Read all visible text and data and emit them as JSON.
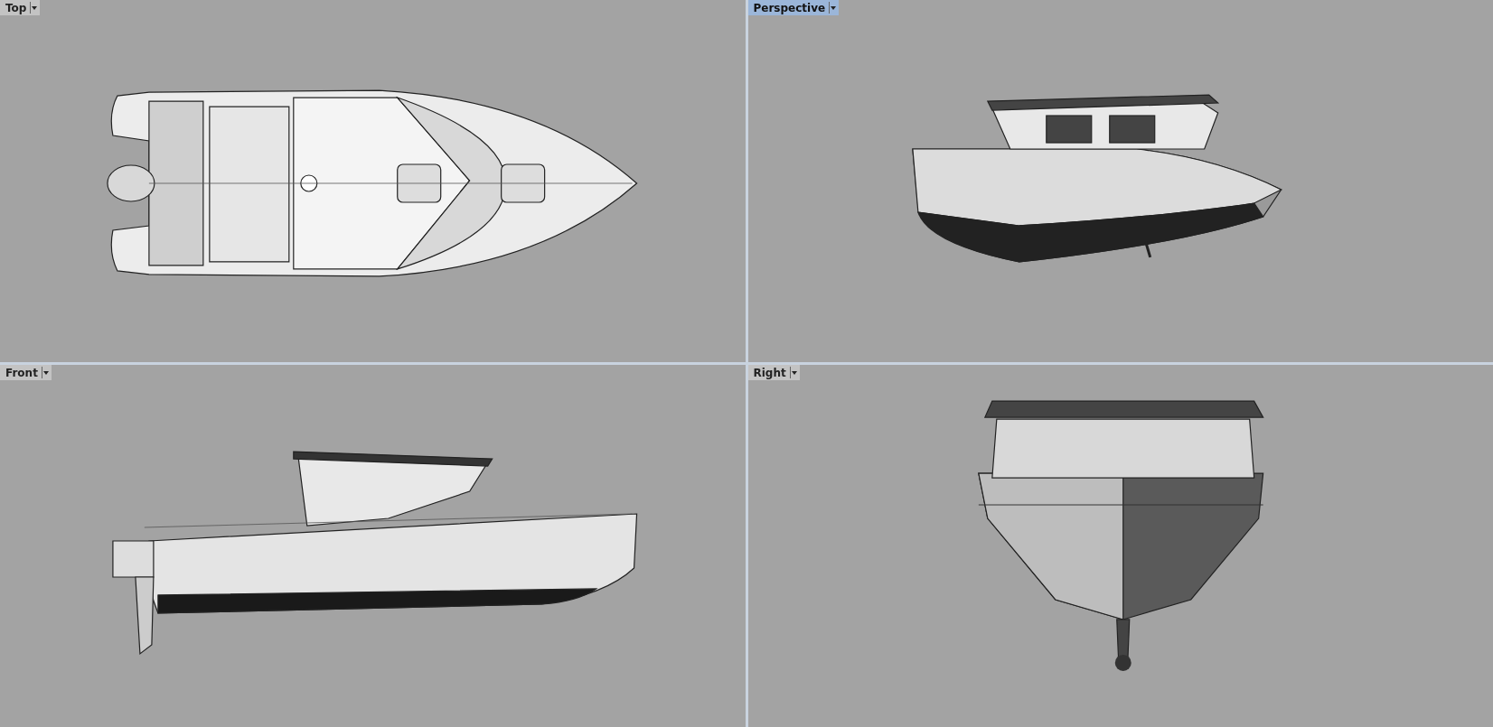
{
  "viewports": [
    {
      "label": "Top",
      "selected": false,
      "kind": "top"
    },
    {
      "label": "Perspective",
      "selected": true,
      "kind": "perspective"
    },
    {
      "label": "Front",
      "selected": false,
      "kind": "front"
    },
    {
      "label": "Right",
      "selected": false,
      "kind": "right"
    }
  ]
}
